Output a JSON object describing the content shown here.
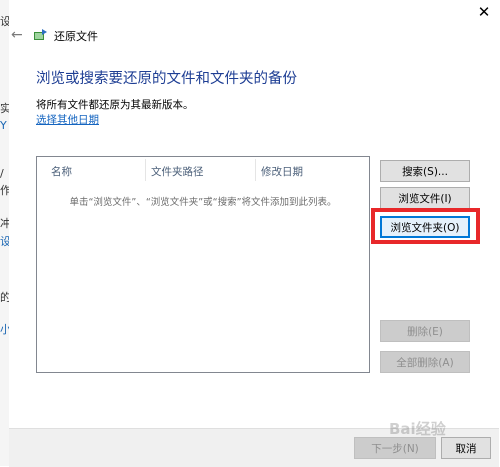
{
  "background_window": {
    "fragments": [
      "设",
      "实",
      "Y",
      "/",
      "作",
      "冲",
      "设",
      "的",
      "小"
    ]
  },
  "dialog": {
    "title": "还原文件",
    "close_glyph": "✕",
    "back_glyph": "←",
    "heading": "浏览或搜索要还原的文件和文件夹的备份",
    "info": "将所有文件都还原为其最新版本。",
    "other_date_link": "选择其他日期"
  },
  "file_list": {
    "columns": [
      "名称",
      "文件夹路径",
      "修改日期"
    ],
    "empty_hint": "单击“浏览文件”、“浏览文件夹”或“搜索”将文件添加到此列表。"
  },
  "buttons": {
    "search": "搜索(S)...",
    "browse_files": "浏览文件(I)",
    "browse_folders": "浏览文件夹(O)",
    "remove": "删除(E)",
    "remove_all": "全部删除(A)",
    "next": "下一步(N)",
    "cancel": "取消"
  },
  "watermark": "Bai经验",
  "colors": {
    "heading": "#1e3e94",
    "link": "#1565c0",
    "highlight": "#e8282a"
  }
}
